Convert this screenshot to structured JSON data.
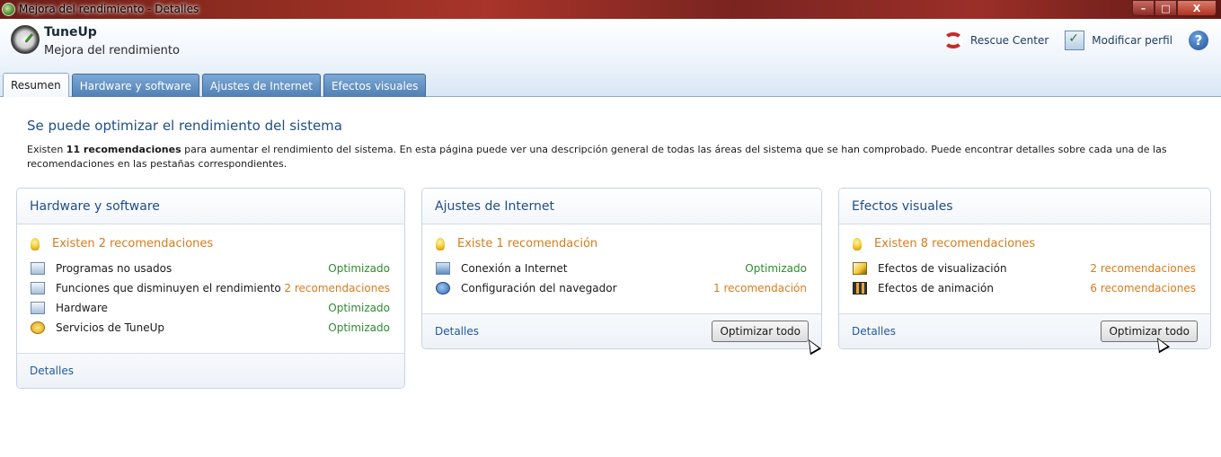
{
  "window": {
    "title": "Mejora del rendimiento - Detalles",
    "min": "–",
    "max": "□",
    "close": "X"
  },
  "header": {
    "app_name": "TuneUp",
    "app_subtitle": "Mejora del rendimiento",
    "rescue": "Rescue Center",
    "profile": "Modificar perfil",
    "help": "?"
  },
  "tabs": [
    {
      "label": "Resumen",
      "active": true
    },
    {
      "label": "Hardware y software"
    },
    {
      "label": "Ajustes de Internet"
    },
    {
      "label": "Efectos visuales"
    }
  ],
  "main": {
    "title": "Se puede optimizar el rendimiento del sistema",
    "intro_pre": "Existen ",
    "intro_bold": "11 recomendaciones",
    "intro_post": " para aumentar el rendimiento del sistema. En esta página puede ver una descripción general de todas las áreas del sistema que se han comprobado. Puede encontrar detalles sobre cada una de las recomendaciones en las pestañas correspondientes."
  },
  "cards": [
    {
      "title": "Hardware y software",
      "summary": "Existen 2 recomendaciones",
      "rows": [
        {
          "label": "Programas no usados",
          "status": "Optimizado"
        },
        {
          "label": "Funciones que disminuyen el rendimiento",
          "status": "2 recomendaciones"
        },
        {
          "label": "Hardware",
          "status": "Optimizado"
        },
        {
          "label": "Servicios de TuneUp",
          "status": "Optimizado"
        }
      ],
      "details": "Detalles"
    },
    {
      "title": "Ajustes de Internet",
      "summary": "Existe 1 recomendación",
      "rows": [
        {
          "label": "Conexión a Internet",
          "status": "Optimizado"
        },
        {
          "label": "Configuración del navegador",
          "status": "1 recomendación"
        }
      ],
      "details": "Detalles",
      "button": "Optimizar todo"
    },
    {
      "title": "Efectos visuales",
      "summary": "Existen 8 recomendaciones",
      "rows": [
        {
          "label": "Efectos de visualización",
          "status": "2 recomendaciones"
        },
        {
          "label": "Efectos de animación",
          "status": "6 recomendaciones"
        }
      ],
      "details": "Detalles",
      "button": "Optimizar todo"
    }
  ]
}
